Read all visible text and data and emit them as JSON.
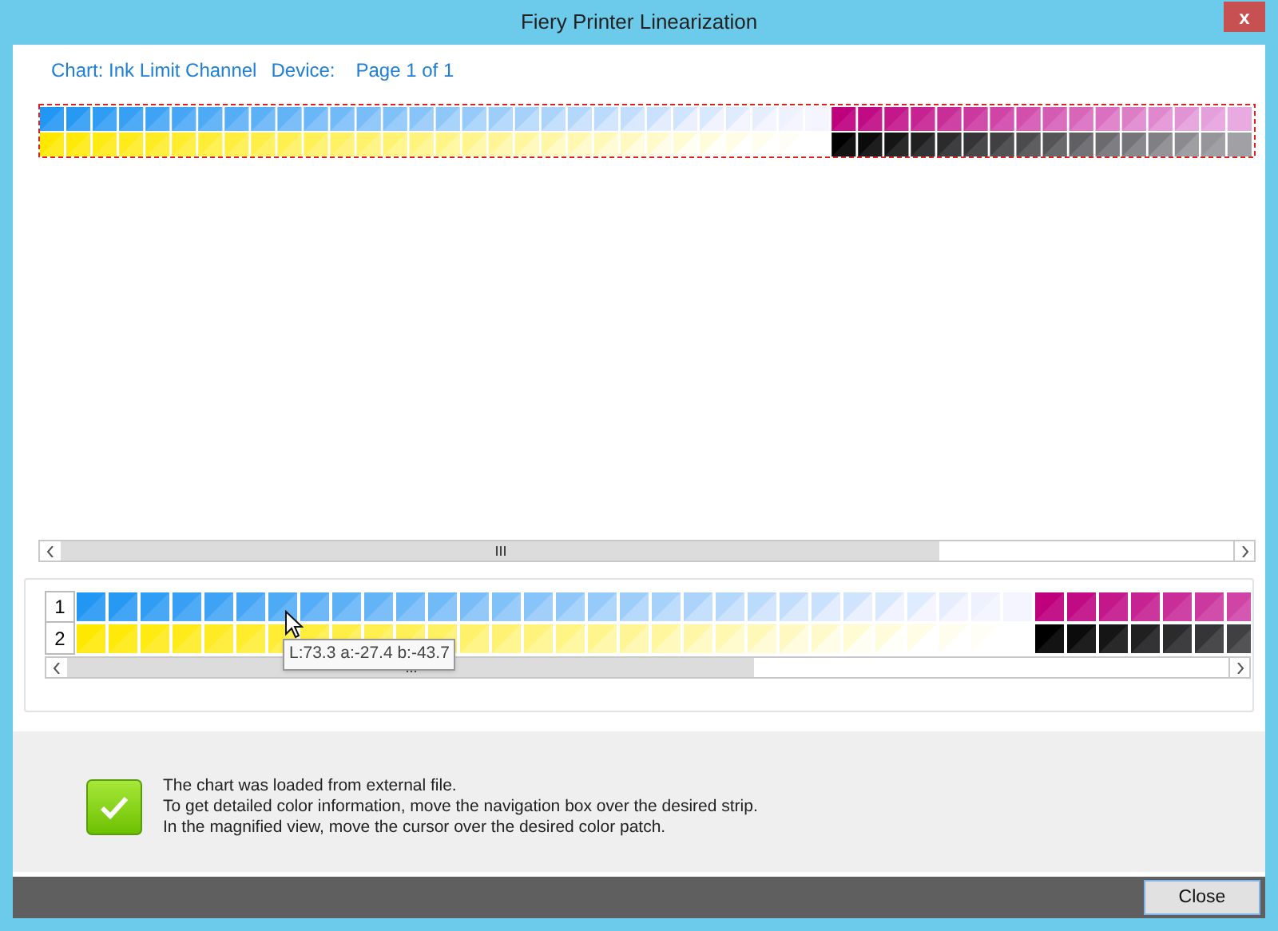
{
  "window": {
    "title": "Fiery Printer Linearization",
    "close_glyph": "x"
  },
  "header": {
    "chart": "Chart: Ink Limit Channel",
    "device": "Device:",
    "page": "Page 1 of 1"
  },
  "magnified_view": {
    "row_labels": [
      "1",
      "2"
    ],
    "tooltip": "L:73.3 a:-27.4 b:-43.7"
  },
  "message": [
    "The chart was loaded from external file.",
    "To get detailed color information, move the navigation box over the desired strip.",
    "In the magnified view, move the cursor over the desired color patch."
  ],
  "buttons": [
    "Close"
  ]
}
